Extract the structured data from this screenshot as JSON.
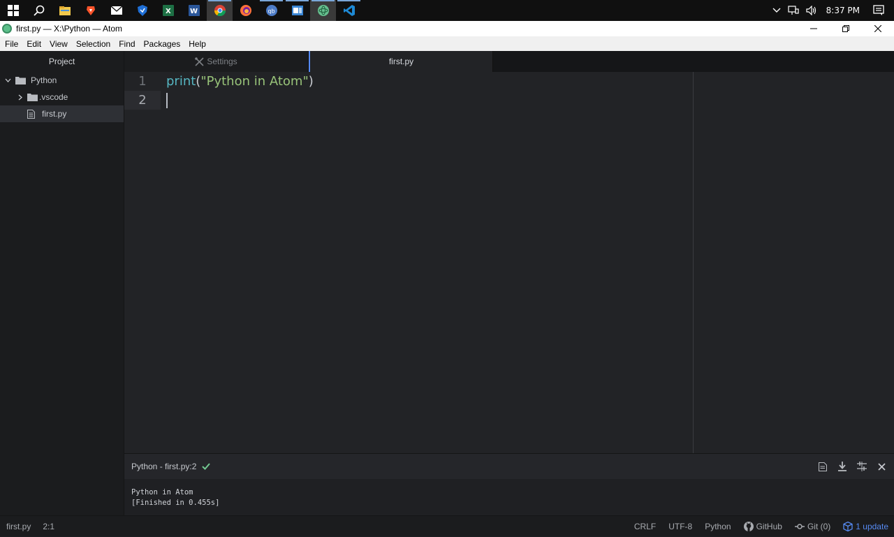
{
  "taskbar": {
    "apps": [
      {
        "name": "windows-start-icon"
      },
      {
        "name": "search-icon"
      },
      {
        "name": "file-explorer-icon"
      },
      {
        "name": "brave-browser-icon"
      },
      {
        "name": "mail-icon"
      },
      {
        "name": "security-shield-icon"
      },
      {
        "name": "excel-icon"
      },
      {
        "name": "word-icon"
      },
      {
        "name": "chrome-icon"
      },
      {
        "name": "firefox-icon"
      },
      {
        "name": "qbittorrent-icon"
      },
      {
        "name": "outlook-icon"
      },
      {
        "name": "atom-icon"
      },
      {
        "name": "vscode-icon"
      }
    ],
    "clock": "8:37 PM"
  },
  "window": {
    "title": "first.py — X:\\Python — Atom"
  },
  "menu": [
    "File",
    "Edit",
    "View",
    "Selection",
    "Find",
    "Packages",
    "Help"
  ],
  "tree": {
    "header": "Project",
    "root": "Python",
    "folder": ".vscode",
    "file": "first.py"
  },
  "tabs": {
    "settings": "Settings",
    "file": "first.py"
  },
  "editor": {
    "line_numbers": [
      "1",
      "2"
    ],
    "fn": "print",
    "open_paren": "(",
    "string": "\"Python in Atom\"",
    "close_paren": ")"
  },
  "panel": {
    "title": "Python - first.py:2",
    "output_line1": "Python in Atom",
    "output_line2": "[Finished in 0.455s]"
  },
  "status": {
    "file": "first.py",
    "cursor": "2:1",
    "line_ending": "CRLF",
    "encoding": "UTF-8",
    "grammar": "Python",
    "github": "GitHub",
    "git": "Git (0)",
    "update": "1 update"
  },
  "colors": {
    "accent": "#568af2",
    "fn": "#56b6c2",
    "string": "#98c379",
    "check": "#73c991"
  }
}
